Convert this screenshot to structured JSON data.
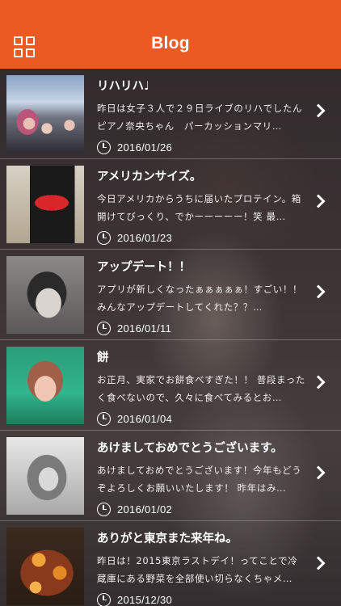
{
  "header": {
    "title": "Blog",
    "menu_icon": "grid-menu-icon",
    "color": "#ea5a22"
  },
  "posts": [
    {
      "title": "リハリハ♩",
      "excerpt": "昨日は女子３人で２９日ライブのリハでしたん　ピアノ奈央ちゃん　パーカッションマリ…",
      "date": "2016/01/26"
    },
    {
      "title": "アメリカンサイズ。",
      "excerpt": "今日アメリカからうちに届いたプロテイン。箱開けてびっくり、でかーーーーー！笑 最…",
      "date": "2016/01/23"
    },
    {
      "title": "アップデート！！",
      "excerpt": "アプリが新しくなったぁぁぁぁぁ！すごい！！みんなアップデートしてくれた？？…",
      "date": "2016/01/11"
    },
    {
      "title": "餅",
      "excerpt": "お正月、実家でお餅食べすぎた！！ 普段まったく食べないので、久々に食べてみるとお…",
      "date": "2016/01/04"
    },
    {
      "title": "あけましておめでとうございます。",
      "excerpt": "あけましておめでとうございます！今年もどうぞよろしくお願いいたします！ 昨年はみ…",
      "date": "2016/01/02"
    },
    {
      "title": "ありがと東京また来年ね。",
      "excerpt": "昨日は！2015東京ラストデイ！ってことで冷蔵庫にある野菜を全部使い切らなくちゃメ…",
      "date": "2015/12/30"
    }
  ],
  "icons": {
    "clock": "clock-icon",
    "chevron": "chevron-right-icon"
  }
}
